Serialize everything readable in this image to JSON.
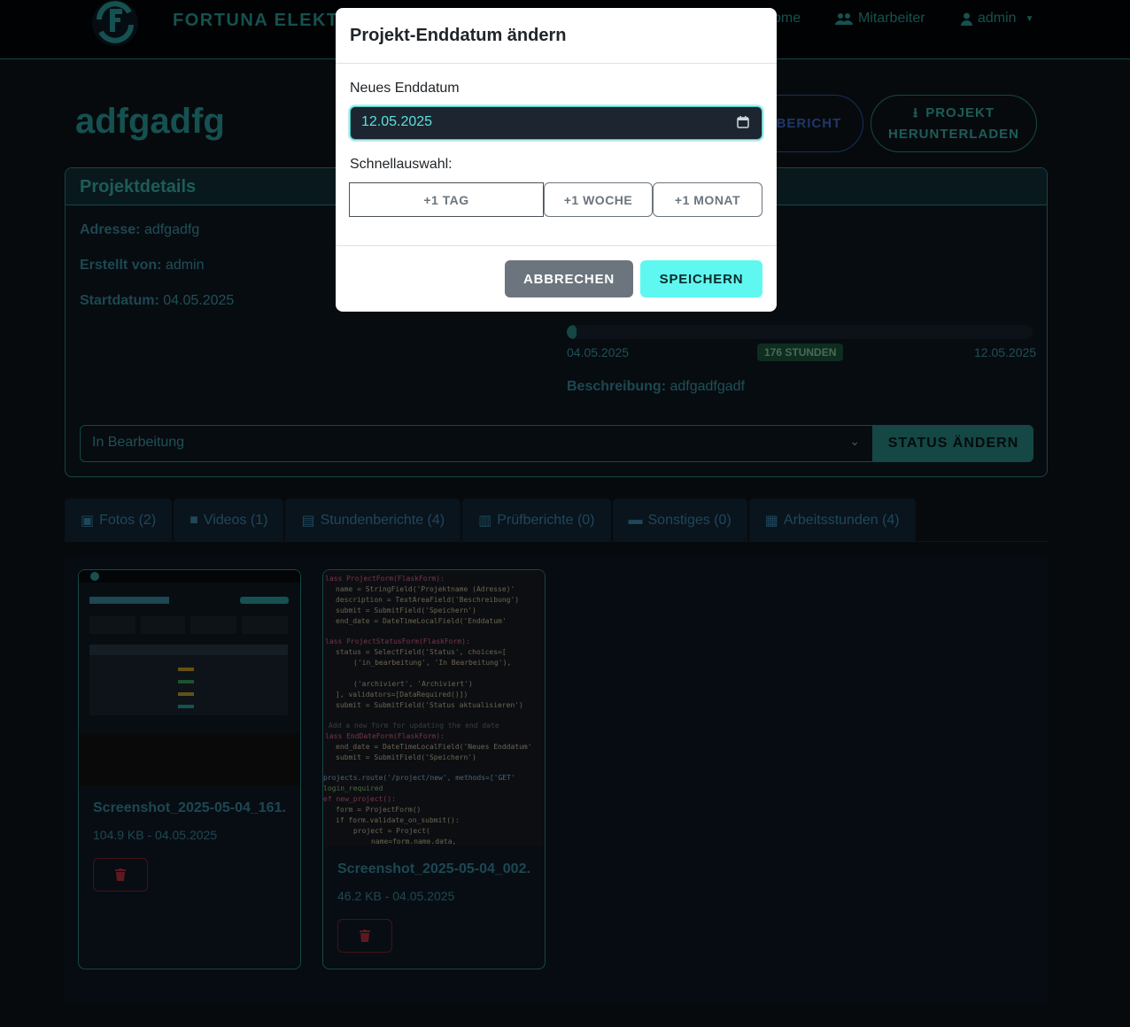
{
  "navbar": {
    "brand": "FORTUNA ELEKTR",
    "home": "ome",
    "employees": "Mitarbeiter",
    "user": "admin"
  },
  "project": {
    "title": "adfgadfg",
    "report_button_line1": "",
    "report_button_line2": "NBERICHT",
    "download_button_line1": "PROJEKT",
    "download_button_line2": "HERUNTERLADEN"
  },
  "details": {
    "header": "Projektdetails",
    "address_label": "Adresse:",
    "address_value": "adfgadfg",
    "created_label": "Erstellt von:",
    "created_value": "admin",
    "start_label": "Startdatum:",
    "start_value": "04.05.2025",
    "progress_fraction": 0.02,
    "progress_start": "04.05.2025",
    "progress_hours": "176 STUNDEN",
    "progress_end": "12.05.2025",
    "description_label": "Beschreibung:",
    "description_value": "adfgadfgadf",
    "status_value": "In Bearbeitung",
    "status_button": "STATUS ÄNDERN"
  },
  "tabs": [
    {
      "label": "Fotos (2)",
      "icon": "image-icon"
    },
    {
      "label": "Videos (1)",
      "icon": "video-icon"
    },
    {
      "label": "Stundenberichte (4)",
      "icon": "file-pdf-icon"
    },
    {
      "label": "Prüfberichte (0)",
      "icon": "clipboard-check-icon"
    },
    {
      "label": "Sonstiges (0)",
      "icon": "folder-icon"
    },
    {
      "label": "Arbeitsstunden (4)",
      "icon": "clipboard-list-icon"
    }
  ],
  "photos": [
    {
      "name": "Screenshot_2025-05-04_161...",
      "meta": "104.9 KB - 04.05.2025"
    },
    {
      "name": "Screenshot_2025-05-04_002...",
      "meta": "46.2 KB - 04.05.2025"
    }
  ],
  "modal": {
    "title": "Projekt-Enddatum ändern",
    "date_label": "Neues Enddatum",
    "date_value": "12.05.2025",
    "quick_label": "Schnellauswahl:",
    "quick_day": "+1 TAG",
    "quick_week": "+1 WOCHE",
    "quick_month": "+1 MONAT",
    "cancel": "ABBRECHEN",
    "save": "SPEICHERN"
  },
  "colors": {
    "accent": "#2aa3a0",
    "save_button": "#5ff8f0",
    "cancel_button": "#6c757d"
  }
}
